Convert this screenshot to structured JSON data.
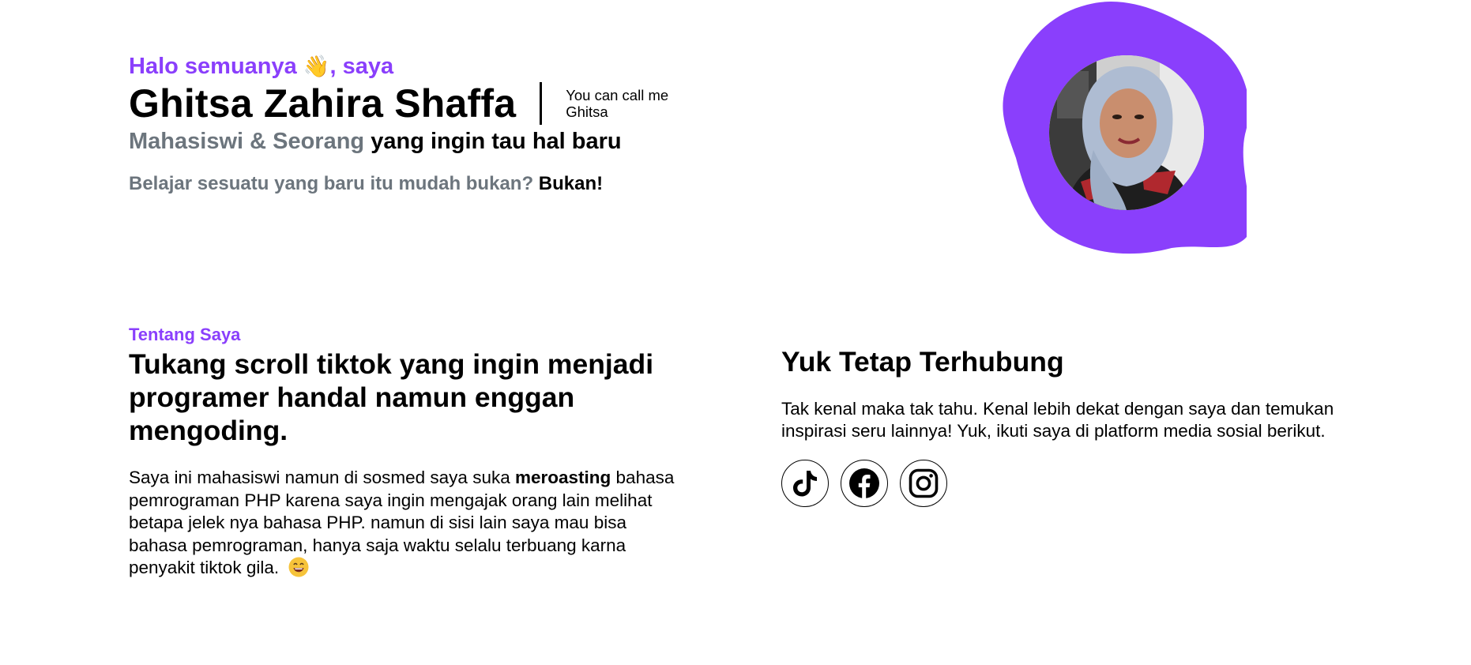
{
  "hero": {
    "greeting": "Halo semuanya",
    "greeting_emoji": "👋",
    "greeting_suffix": ", saya",
    "name": "Ghitsa Zahira Shaffa",
    "nickname": "You can call me Ghitsa",
    "role_muted": "Mahasiswi & Seorang",
    "role_strong": "yang ingin tau hal baru",
    "tagline_muted": "Belajar sesuatu yang baru itu mudah bukan?",
    "tagline_strong": "Bukan!"
  },
  "avatar": {
    "blob_color": "#8a3ffc"
  },
  "about": {
    "label": "Tentang Saya",
    "title": "Tukang scroll tiktok yang ingin menjadi programer handal namun enggan mengoding.",
    "body_part1": "Saya ini mahasiswi namun di sosmed saya suka",
    "body_bold": "meroasting",
    "body_part2": "bahasa pemrograman PHP karena saya ingin mengajak orang lain melihat betapa jelek nya bahasa PHP. namun di sisi lain saya mau bisa bahasa pemrograman, hanya saja waktu selalu terbuang karna penyakit tiktok gila.",
    "body_emoji": "😄"
  },
  "contact": {
    "title": "Yuk Tetap Terhubung",
    "body": "Tak kenal maka tak tahu. Kenal lebih dekat dengan saya dan temukan inspirasi seru lainnya! Yuk, ikuti saya di platform media sosial berikut.",
    "socials": [
      {
        "icon": "tiktok-icon"
      },
      {
        "icon": "facebook-icon"
      },
      {
        "icon": "instagram-icon"
      }
    ]
  },
  "colors": {
    "accent": "#8a3ffc",
    "muted": "#6c757d"
  }
}
